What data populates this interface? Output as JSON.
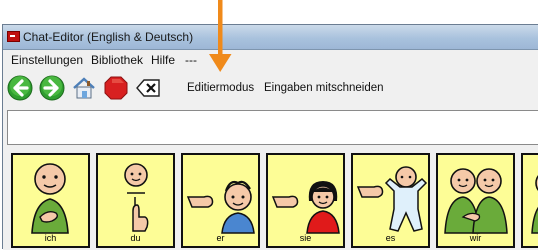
{
  "window": {
    "title": "Chat-Editor (English & Deutsch)"
  },
  "menu": {
    "items": [
      "Einstellungen",
      "Bibliothek",
      "Hilfe",
      "---"
    ]
  },
  "toolbar": {
    "back_icon": "green-left-arrow-icon",
    "forward_icon": "green-right-arrow-icon",
    "home_icon": "home-icon",
    "stop_icon": "red-stop-icon",
    "clear_icon": "backspace-clear-icon",
    "edit_mode_label": "Editiermodus",
    "record_input_label": "Eingaben mitschneiden"
  },
  "input": {
    "value": ""
  },
  "tiles": [
    {
      "label": "ich",
      "icon": "person-pointing-self-icon"
    },
    {
      "label": "du",
      "icon": "person-pointing-you-icon"
    },
    {
      "label": "er",
      "icon": "pointing-at-boy-icon"
    },
    {
      "label": "sie",
      "icon": "pointing-at-girl-icon"
    },
    {
      "label": "es",
      "icon": "pointing-at-baby-icon"
    },
    {
      "label": "wir",
      "icon": "two-people-icon"
    },
    {
      "label": "",
      "icon": "person-partial-icon"
    }
  ],
  "colors": {
    "tile_background": "#fdfd96",
    "annotation_arrow": "#f08a1a",
    "toolbar_green": "#3bb33b",
    "stop_red": "#d82020"
  }
}
